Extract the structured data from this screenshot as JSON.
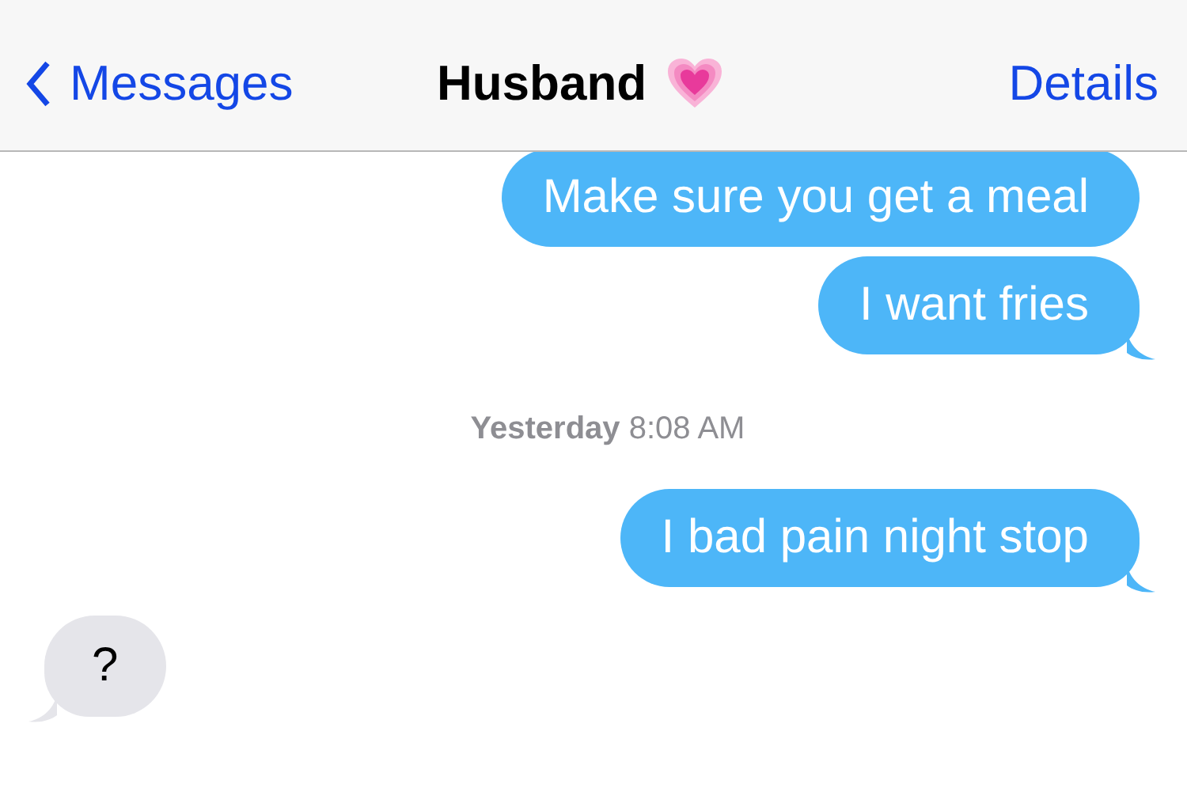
{
  "nav_bar": {
    "back_label": "Messages",
    "title": "Husband",
    "action": "Details"
  },
  "messages": [
    {
      "kind": "sent",
      "text": "Make sure you get a meal",
      "tail": false
    },
    {
      "kind": "sent",
      "text": "I want fries",
      "tail": true
    },
    {
      "kind": "timestamp",
      "text": "**Yesterday** 8:08 AM"
    },
    {
      "kind": "sent",
      "text": "I bad pain night stop",
      "tail": true
    },
    {
      "kind": "received",
      "text": "?",
      "tail": true
    }
  ]
}
